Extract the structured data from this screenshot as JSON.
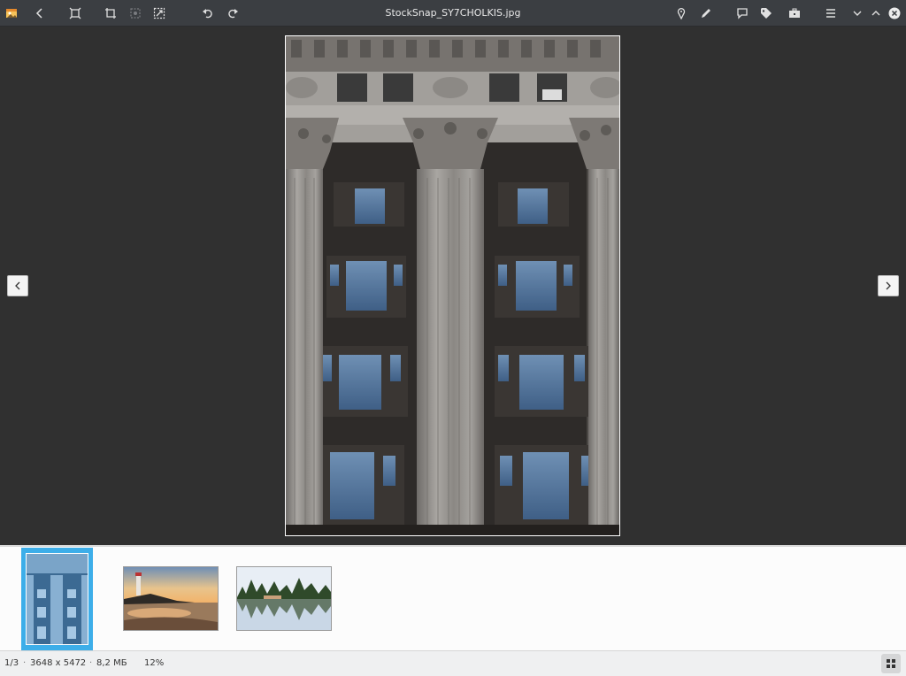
{
  "window": {
    "title": "StockSnap_SY7CHOLKIS.jpg"
  },
  "toolbar": {
    "left_icons": [
      "app-icon",
      "back-icon",
      "zoom-to-fit-icon",
      "crop-icon",
      "reduce-red-eye-icon",
      "resize-icon",
      "rotate-left-icon",
      "rotate-right-icon"
    ],
    "right_icons": [
      "location-icon",
      "draw-icon",
      "comment-icon",
      "tag-icon",
      "toolbox-icon",
      "menu-icon",
      "minimize-icon",
      "maximize-icon",
      "close-icon"
    ]
  },
  "viewer": {
    "prev_icon": "chevron-left-icon",
    "next_icon": "chevron-right-icon"
  },
  "filmstrip": {
    "thumbnails": [
      "building-columns",
      "lighthouse-coast",
      "lake-reflection"
    ],
    "selected_index": 0
  },
  "status": {
    "position": "1/3",
    "separator": "·",
    "dimensions": "3648 x 5472",
    "size": "8,2 МБ",
    "zoom": "12%"
  },
  "colors": {
    "selection": "#3daee9",
    "toolbar_bg": "#3b3e42",
    "viewer_bg": "#303030"
  }
}
